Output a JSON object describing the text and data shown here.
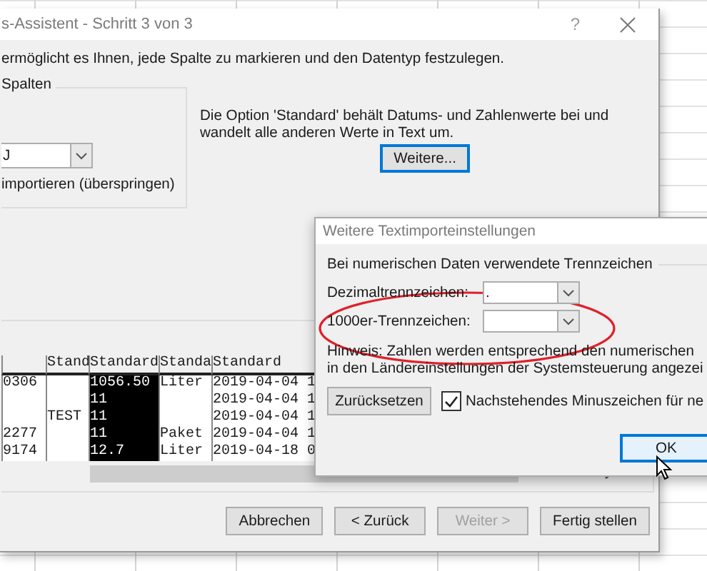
{
  "main_dialog": {
    "title": "s-Assistent - Schritt 3 von 3",
    "help": "?",
    "intro": "ermöglicht es Ihnen, jede Spalte zu markieren und den Datentyp festzulegen.",
    "column_group": {
      "label": "Spalten",
      "dropdown_value": "J",
      "radio_label": "importieren (überspringen)"
    },
    "info_text": "Die Option 'Standard' behält Datums- und Zahlenwerte bei und wandelt alle anderen Werte in Text um.",
    "more_button": "Weitere...",
    "preview": {
      "columns": [
        {
          "selected": false
        },
        {
          "header": "Stand",
          "selected": false
        },
        {
          "header": "Standard",
          "selected": true
        },
        {
          "header": "Standa",
          "selected": false
        },
        {
          "header": "Standard",
          "selected": false
        }
      ],
      "rows": [
        [
          "0306",
          null,
          "1056.50",
          "Liter",
          "2019-04-04 1"
        ],
        [
          null,
          null,
          "11",
          null,
          "2019-04-04 1"
        ],
        [
          null,
          "TEST",
          "11",
          null,
          "2019-04-04 1"
        ],
        [
          "2277",
          null,
          "11",
          "Paket",
          "2019-04-04 1"
        ],
        [
          "9174",
          null,
          "12.7",
          "Liter",
          "2019-04-18 0"
        ]
      ]
    },
    "buttons": [
      {
        "label": "Abbrechen",
        "disabled": false
      },
      {
        "label": "< Zurück",
        "disabled": false
      },
      {
        "label": "Weiter >",
        "disabled": true
      },
      {
        "label": "Fertig stellen",
        "disabled": false
      }
    ]
  },
  "sub_dialog": {
    "title": "Weitere Textimporteinstellungen",
    "group_label": "Bei numerischen Daten verwendete Trennzeichen",
    "fields": [
      {
        "label": "Dezimaltrennzeichen:",
        "value": "."
      },
      {
        "label": "1000er-Trennzeichen:"
      }
    ],
    "hint": [
      "Hinweis: Zahlen werden entsprechend den numerischen",
      "in den Ländereinstellungen der Systemsteuerung angezei"
    ],
    "reset_button": "Zurücksetzen",
    "checkbox": {
      "label": "Nachstehendes Minuszeichen für ne",
      "checked": true
    },
    "ok_button": "OK"
  }
}
